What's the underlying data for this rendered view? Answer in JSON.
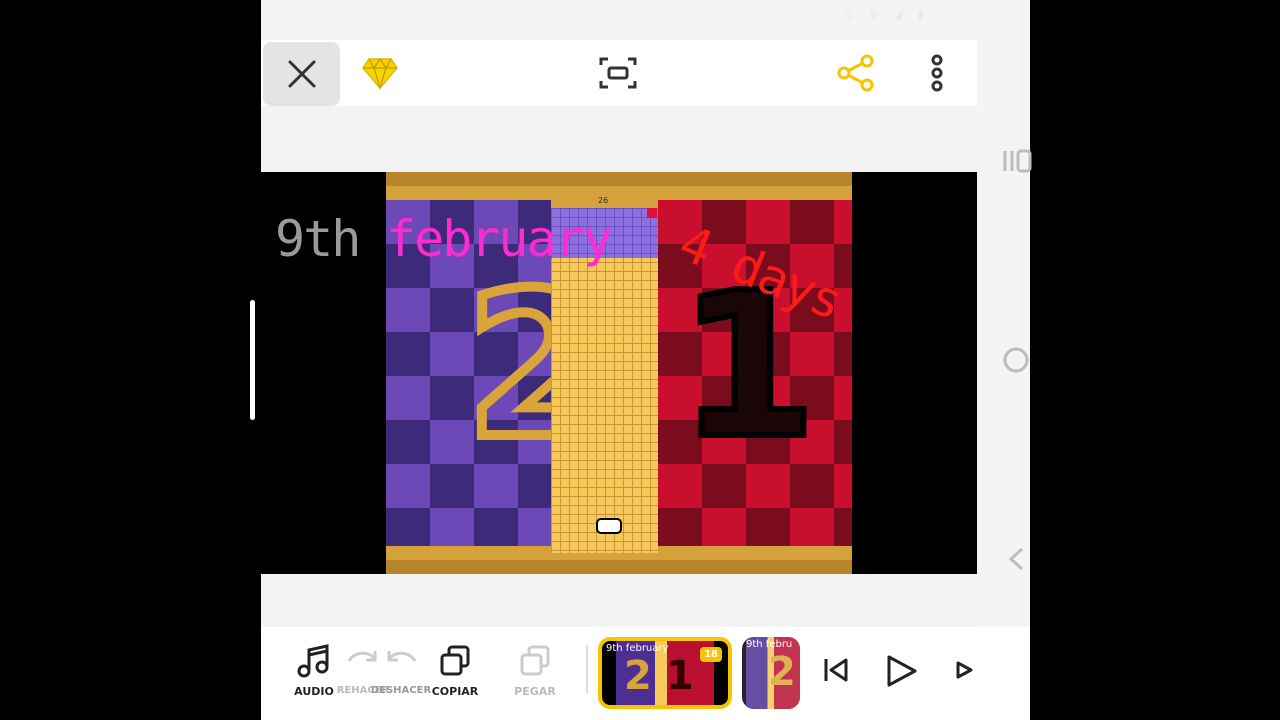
{
  "colors": {
    "accent": "#f7c500",
    "share": "#f7c500",
    "month_text": "#ff2bd0",
    "days_text": "#ff1a1a",
    "date_text": "#9a9a9a"
  },
  "topbar": {
    "icons": [
      "close-icon",
      "premium-gem-icon",
      "screen-capture-icon",
      "share-icon",
      "more-vertical-icon"
    ]
  },
  "preview": {
    "overlay_date": "9th",
    "overlay_month": "february",
    "overlay_days": "4 days",
    "left_number": "2",
    "right_number": "1",
    "grid_label": "26"
  },
  "toolbar": {
    "audio": "AUDIO",
    "redo": "REHACER",
    "undo": "DESHACER",
    "copy": "COPIAR",
    "paste": "PEGAR"
  },
  "timeline": {
    "clip_active_text": "9th february",
    "clip_active_badge": "18",
    "clip_next_text": "9th febru",
    "clip_num_two": "2",
    "clip_num_one": "1"
  },
  "playback": {
    "icons": [
      "skip-to-start-icon",
      "play-icon",
      "next-frame-icon"
    ]
  }
}
